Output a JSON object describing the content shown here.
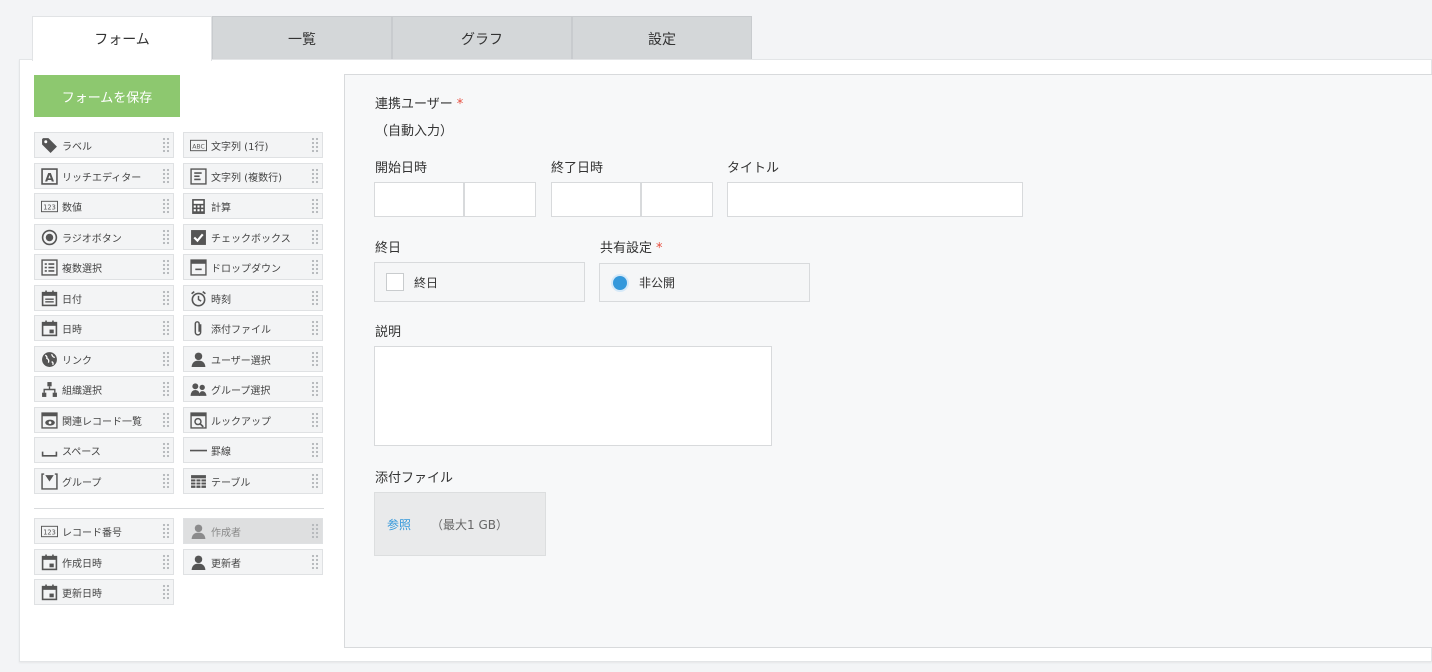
{
  "tabs": [
    "フォーム",
    "一覧",
    "グラフ",
    "設定"
  ],
  "save_button": "フォームを保存",
  "palette": [
    {
      "label": "ラベル",
      "icon": "tag-icon"
    },
    {
      "label": "文字列 (1行)",
      "icon": "abc-text-icon"
    },
    {
      "label": "リッチエディター",
      "icon": "rich-editor-icon"
    },
    {
      "label": "文字列 (複数行)",
      "icon": "multiline-text-icon"
    },
    {
      "label": "数値",
      "icon": "number-icon"
    },
    {
      "label": "計算",
      "icon": "calculator-icon"
    },
    {
      "label": "ラジオボタン",
      "icon": "radio-button-icon"
    },
    {
      "label": "チェックボックス",
      "icon": "checkbox-icon"
    },
    {
      "label": "複数選択",
      "icon": "multi-select-icon"
    },
    {
      "label": "ドロップダウン",
      "icon": "dropdown-icon"
    },
    {
      "label": "日付",
      "icon": "date-icon"
    },
    {
      "label": "時刻",
      "icon": "clock-icon"
    },
    {
      "label": "日時",
      "icon": "datetime-icon"
    },
    {
      "label": "添付ファイル",
      "icon": "paperclip-icon"
    },
    {
      "label": "リンク",
      "icon": "globe-icon"
    },
    {
      "label": "ユーザー選択",
      "icon": "user-icon"
    },
    {
      "label": "組織選択",
      "icon": "org-icon"
    },
    {
      "label": "グループ選択",
      "icon": "group-icon"
    },
    {
      "label": "関連レコード一覧",
      "icon": "related-records-icon"
    },
    {
      "label": "ルックアップ",
      "icon": "lookup-icon"
    },
    {
      "label": "スペース",
      "icon": "space-icon"
    },
    {
      "label": "罫線",
      "icon": "line-icon"
    },
    {
      "label": "グループ",
      "icon": "group-field-icon"
    },
    {
      "label": "テーブル",
      "icon": "table-icon"
    }
  ],
  "system_fields": [
    {
      "label": "レコード番号",
      "icon": "number-icon",
      "disabled": false
    },
    {
      "label": "作成者",
      "icon": "user-icon",
      "disabled": true
    },
    {
      "label": "作成日時",
      "icon": "datetime-icon",
      "disabled": false
    },
    {
      "label": "更新者",
      "icon": "user-icon",
      "disabled": false
    },
    {
      "label": "更新日時",
      "icon": "datetime-icon",
      "disabled": false
    }
  ],
  "form": {
    "linked_user_label": "連携ユーザー",
    "linked_user_value": "（自動入力）",
    "required_mark": "*",
    "start_label": "開始日時",
    "end_label": "終了日時",
    "title_label": "タイトル",
    "allday_label": "終日",
    "allday_option": "終日",
    "share_label": "共有設定",
    "share_option": "非公開",
    "description_label": "説明",
    "attachment_label": "添付ファイル",
    "browse_label": "参照",
    "max_size": "（最大1 GB）"
  },
  "colors": {
    "accent_green": "#8dc86f",
    "link_blue": "#3498db",
    "required_red": "#e74c3c"
  }
}
